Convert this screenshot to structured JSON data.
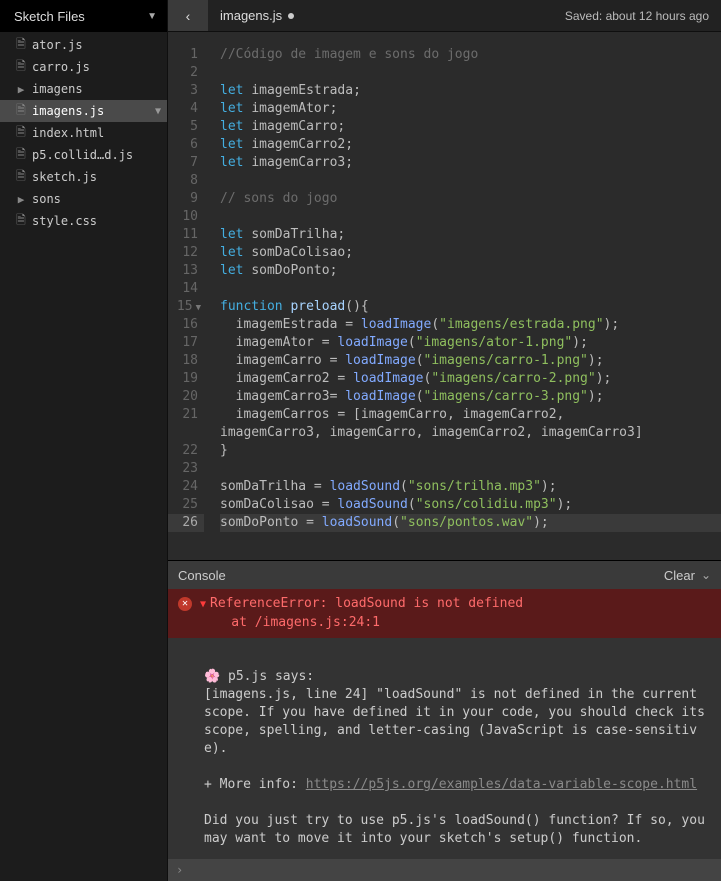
{
  "sidebar": {
    "title": "Sketch Files",
    "items": [
      {
        "icon": "file",
        "name": "ator.js"
      },
      {
        "icon": "file",
        "name": "carro.js"
      },
      {
        "icon": "folder",
        "name": "imagens"
      },
      {
        "icon": "file",
        "name": "imagens.js",
        "selected": true,
        "chevron": true
      },
      {
        "icon": "file",
        "name": "index.html"
      },
      {
        "icon": "file",
        "name": "p5.collid…d.js"
      },
      {
        "icon": "file",
        "name": "sketch.js"
      },
      {
        "icon": "folder",
        "name": "sons"
      },
      {
        "icon": "file",
        "name": "style.css"
      }
    ]
  },
  "tabbar": {
    "filename": "imagens.js",
    "dirty": true,
    "saved": "Saved: about 12 hours ago"
  },
  "code": {
    "line_count": 26,
    "active_line": 26,
    "fold_line": 15,
    "lines": {
      "1": {
        "comment": "//Código de imagem e sons do jogo"
      },
      "3": {
        "kw": "let",
        "id": "imagemEstrada",
        "tail": ";"
      },
      "4": {
        "kw": "let",
        "id": "imagemAtor",
        "tail": ";"
      },
      "5": {
        "kw": "let",
        "id": "imagemCarro",
        "tail": ";"
      },
      "6": {
        "kw": "let",
        "id": "imagemCarro2",
        "tail": ";"
      },
      "7": {
        "kw": "let",
        "id": "imagemCarro3",
        "tail": ";"
      },
      "9": {
        "comment": "// sons do jogo"
      },
      "11": {
        "kw": "let",
        "id": "somDaTrilha",
        "tail": ";"
      },
      "12": {
        "kw": "let",
        "id": "somDaColisao",
        "tail": ";"
      },
      "13": {
        "kw": "let",
        "id": "somDoPonto",
        "tail": ";"
      },
      "15": {
        "func_kw": "function",
        "func_name": "preload",
        "func_tail": "(){"
      },
      "16": {
        "indent": "  ",
        "id": "imagemEstrada",
        "eq": " = ",
        "call": "loadImage",
        "open": "(",
        "str": "\"imagens/estrada.png\"",
        "close": ");"
      },
      "17": {
        "indent": "  ",
        "id": "imagemAtor",
        "eq": " = ",
        "call": "loadImage",
        "open": "(",
        "str": "\"imagens/ator-1.png\"",
        "close": ");"
      },
      "18": {
        "indent": "  ",
        "id": "imagemCarro",
        "eq": " = ",
        "call": "loadImage",
        "open": "(",
        "str": "\"imagens/carro-1.png\"",
        "close": ");"
      },
      "19": {
        "indent": "  ",
        "id": "imagemCarro2",
        "eq": " = ",
        "call": "loadImage",
        "open": "(",
        "str": "\"imagens/carro-2.png\"",
        "close": ");"
      },
      "20": {
        "indent": "  ",
        "id": "imagemCarro3",
        "eq": "= ",
        "call": "loadImage",
        "open": "(",
        "str": "\"imagens/carro-3.png\"",
        "close": ");"
      },
      "21a": {
        "indent": "  ",
        "id": "imagemCarros",
        "eq": " = [",
        "list": "imagemCarro, imagemCarro2,"
      },
      "21b": {
        "list": "imagemCarro3, imagemCarro, imagemCarro2, imagemCarro3",
        "close": "]"
      },
      "22": {
        "raw": "}"
      },
      "24": {
        "id": "somDaTrilha",
        "eq": " = ",
        "call": "loadSound",
        "open": "(",
        "str": "\"sons/trilha.mp3\"",
        "close": ");"
      },
      "25": {
        "id": "somDaColisao",
        "eq": " = ",
        "call": "loadSound",
        "open": "(",
        "str": "\"sons/colidiu.mp3\"",
        "close": ");"
      },
      "26": {
        "id": "somDoPonto",
        "eq": " = ",
        "call": "loadSound",
        "open": "(",
        "str": "\"sons/pontos.wav\"",
        "close": ");"
      }
    }
  },
  "console": {
    "title": "Console",
    "clear": "Clear",
    "error_line1": "ReferenceError: loadSound is not defined",
    "error_line2": "    at /imagens.js:24:1",
    "p5_says": "🌸 p5.js says:",
    "p5_msg1": "[imagens.js, line 24] \"loadSound\" is not defined in the current scope. If you have defined it in your code, you should check its scope, spelling, and letter-casing (JavaScript is case-sensitive).",
    "more_info": "+ More info: ",
    "more_link": "https://p5js.org/examples/data-variable-scope.html",
    "p5_msg2": "Did you just try to use p5.js's loadSound() function? If so, you may want to move it into your sketch's setup() function.",
    "prompt": "›"
  }
}
